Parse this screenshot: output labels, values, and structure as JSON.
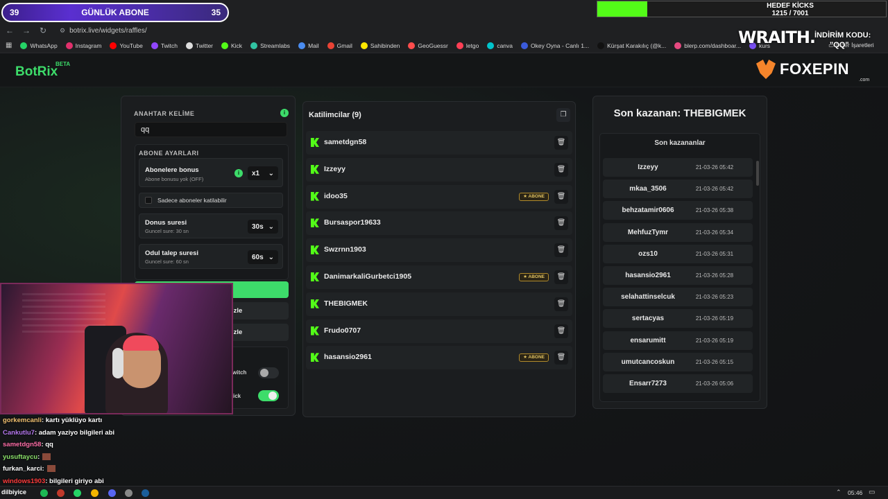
{
  "overlays": {
    "sub_goal": {
      "left": "39",
      "title": "GÜNLÜK ABONE",
      "right": "35"
    },
    "kick_goal": {
      "title": "HEDEF KİCKS",
      "progress": "1215 / 7001",
      "fraction": 0.1735
    },
    "wraith": "WRAITH.",
    "promo_label": "İNDİRİM KODU:",
    "promo_code": "\"QQ\""
  },
  "browser": {
    "url": "botrix.live/widgets/raffles/",
    "bookmarks": [
      {
        "label": "WhatsApp",
        "color": "#25d366"
      },
      {
        "label": "Instagram",
        "color": "#e1306c"
      },
      {
        "label": "YouTube",
        "color": "#ff0000"
      },
      {
        "label": "Twitch",
        "color": "#9146ff"
      },
      {
        "label": "Twitter",
        "color": "#dddddd"
      },
      {
        "label": "Kick",
        "color": "#53fc18"
      },
      {
        "label": "Streamlabs",
        "color": "#31c3a2"
      },
      {
        "label": "Mail",
        "color": "#4a8cf0"
      },
      {
        "label": "Gmail",
        "color": "#ea4335"
      },
      {
        "label": "Sahibinden",
        "color": "#ffe800"
      },
      {
        "label": "GeoGuessr",
        "color": "#ff4d4d"
      },
      {
        "label": "letgo",
        "color": "#ff3f55"
      },
      {
        "label": "canva",
        "color": "#00c4cc"
      },
      {
        "label": "Okey Oyna - Canlı 1...",
        "color": "#3b5bdb"
      },
      {
        "label": "Kürşat Karakılıç (@k...",
        "color": "#111111"
      },
      {
        "label": "blerp.com/dashboar...",
        "color": "#e64980"
      },
      {
        "label": "kurs",
        "color": "#7950f2"
      }
    ],
    "bookmarks_right": "Diğer İşaretleri"
  },
  "header": {
    "logo": "BotRix",
    "beta": "BETA",
    "sponsor": "FOXEPIN",
    "sponsor_sub": ".com"
  },
  "settings": {
    "keyword_label": "ANAHTAR KELİME",
    "keyword_value": "qq",
    "info": "i",
    "sub_settings_label": "ABONE AYARLARI",
    "sub_bonus_title": "Abonelere bonus",
    "sub_bonus_sub": "Abone bonusu yok (OFF)",
    "sub_bonus_value": "x1",
    "only_subs_label": "Sadece aboneler katilabilir",
    "duration_title": "Donus suresi",
    "duration_sub": "Guncel sure: 30 sn",
    "duration_value": "30s",
    "claim_title": "Odul talep suresi",
    "claim_sub": "Guncel sure: 60 sn",
    "claim_value": "60s",
    "btn2_label": "izle",
    "btn3_label": "izle",
    "twitch_label": "witch",
    "kick_label": "ick"
  },
  "participants": {
    "title": "Katilimcilar (9)",
    "badge_label": "ABONE",
    "items": [
      {
        "name": "sametdgn58",
        "sub": false
      },
      {
        "name": "Izzeyy",
        "sub": false
      },
      {
        "name": "idoo35",
        "sub": true
      },
      {
        "name": "Bursaspor19633",
        "sub": false
      },
      {
        "name": "Swzrnn1903",
        "sub": false
      },
      {
        "name": "DanimarkaliGurbetci1905",
        "sub": true
      },
      {
        "name": "THEBIGMEK",
        "sub": false
      },
      {
        "name": "Frudo0707",
        "sub": false
      },
      {
        "name": "hasansio2961",
        "sub": true
      }
    ]
  },
  "winners": {
    "last_winner": "Son kazanan: THEBIGMEK",
    "list_title": "Son kazananlar",
    "items": [
      {
        "name": "Izzeyy",
        "date": "21-03-26 05:42"
      },
      {
        "name": "mkaa_3506",
        "date": "21-03-26 05:42"
      },
      {
        "name": "behzatamir0606",
        "date": "21-03-26 05:38"
      },
      {
        "name": "MehfuzTymr",
        "date": "21-03-26 05:34"
      },
      {
        "name": "ozs10",
        "date": "21-03-26 05:31"
      },
      {
        "name": "hasansio2961",
        "date": "21-03-26 05:28"
      },
      {
        "name": "selahattinselcuk",
        "date": "21-03-26 05:23"
      },
      {
        "name": "sertacyas",
        "date": "21-03-26 05:19"
      },
      {
        "name": "ensarumitt",
        "date": "21-03-26 05:19"
      },
      {
        "name": "umutcancoskun",
        "date": "21-03-26 05:15"
      },
      {
        "name": "Ensarr7273",
        "date": "21-03-26 05:06"
      }
    ]
  },
  "chat": [
    {
      "user": "gorkemcanli",
      "color": "#f0c070",
      "msg": ": kartı yüklüyo kartı"
    },
    {
      "user": "Cankutlu7",
      "color": "#b678f0",
      "msg": ": adam yaziyo bilgileri abi"
    },
    {
      "user": "sametdgn58",
      "color": "#ff6ea8",
      "msg": ": qq"
    },
    {
      "user": "yusuftaycu",
      "color": "#8be06a",
      "msg": ":",
      "emote": true
    },
    {
      "user": "furkan_karci",
      "color": "#ffffff",
      "msg": ":",
      "emote": true
    },
    {
      "user": "windows1903",
      "color": "#ff3b3b",
      "msg": ": bilgileri giriyo abi"
    }
  ],
  "taskbar": {
    "user": "dilbiyice",
    "time": "05:46"
  }
}
